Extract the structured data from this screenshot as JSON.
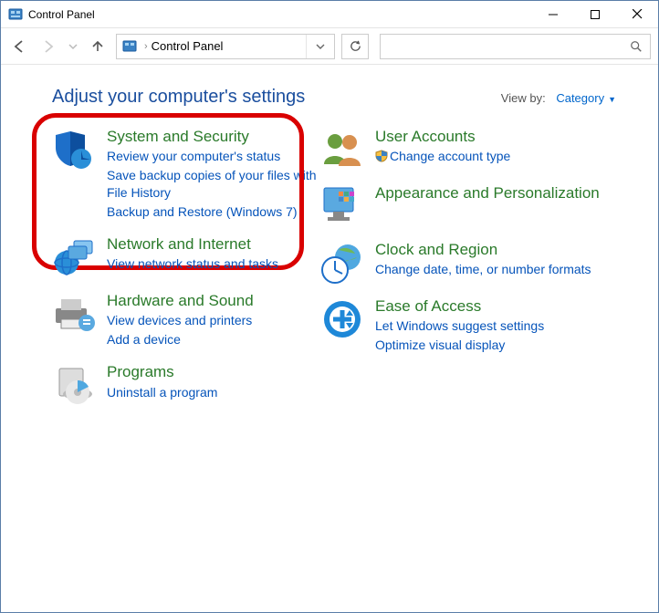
{
  "window": {
    "title": "Control Panel"
  },
  "nav": {
    "breadcrumb": "Control Panel",
    "search_placeholder": ""
  },
  "header": {
    "title": "Adjust your computer's settings"
  },
  "viewby": {
    "label": "View by:",
    "value": "Category"
  },
  "left": [
    {
      "title": "System and Security",
      "links": [
        "Review your computer's status",
        "Save backup copies of your files with File History",
        "Backup and Restore (Windows 7)"
      ],
      "highlight": true
    },
    {
      "title": "Network and Internet",
      "links": [
        "View network status and tasks"
      ]
    },
    {
      "title": "Hardware and Sound",
      "links": [
        "View devices and printers",
        "Add a device"
      ]
    },
    {
      "title": "Programs",
      "links": [
        "Uninstall a program"
      ]
    }
  ],
  "right": [
    {
      "title": "User Accounts",
      "links": [
        "Change account type"
      ],
      "shield": true
    },
    {
      "title": "Appearance and Personalization",
      "links": []
    },
    {
      "title": "Clock and Region",
      "links": [
        "Change date, time, or number formats"
      ]
    },
    {
      "title": "Ease of Access",
      "links": [
        "Let Windows suggest settings",
        "Optimize visual display"
      ]
    }
  ]
}
